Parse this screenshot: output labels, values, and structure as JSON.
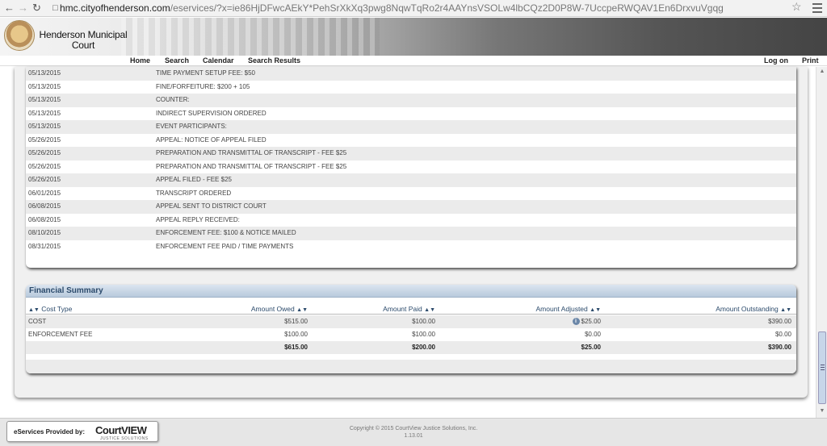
{
  "browser": {
    "url_domain": "hmc.cityofhenderson.com",
    "url_rest": "/eservices/?x=ie86HjDFwcAEkY*PehSrXkXq3pwg8NqwTqRo2r4AAYnsVSOLw4lbCQz2D0P8W-7UccpeRWQAV1En6DrxvuVgqg"
  },
  "header": {
    "court_name_line1": "Henderson Municipal",
    "court_name_line2": "Court",
    "nav": [
      "Home",
      "Search",
      "Calendar",
      "Search Results"
    ],
    "right_nav": [
      "Log on",
      "Print"
    ]
  },
  "events": [
    {
      "date": "05/13/2015",
      "text": "TIME PAYMENT SETUP FEE: $50"
    },
    {
      "date": "05/13/2015",
      "text": "FINE/FORFEITURE: $200 + 105"
    },
    {
      "date": "05/13/2015",
      "text": "COUNTER:"
    },
    {
      "date": "05/13/2015",
      "text": "INDIRECT SUPERVISION ORDERED"
    },
    {
      "date": "05/13/2015",
      "text": "EVENT PARTICIPANTS:"
    },
    {
      "date": "05/26/2015",
      "text": "APPEAL: NOTICE OF APPEAL FILED"
    },
    {
      "date": "05/26/2015",
      "text": "PREPARATION AND TRANSMITTAL OF TRANSCRIPT - FEE $25"
    },
    {
      "date": "05/26/2015",
      "text": "PREPARATION AND TRANSMITTAL OF TRANSCRIPT - FEE $25"
    },
    {
      "date": "05/26/2015",
      "text": "APPEAL FILED - FEE $25"
    },
    {
      "date": "06/01/2015",
      "text": "TRANSCRIPT ORDERED"
    },
    {
      "date": "06/08/2015",
      "text": "APPEAL SENT TO DISTRICT COURT"
    },
    {
      "date": "06/08/2015",
      "text": "APPEAL REPLY RECEIVED:"
    },
    {
      "date": "08/10/2015",
      "text": "ENFORCEMENT FEE: $100 & NOTICE MAILED"
    },
    {
      "date": "08/31/2015",
      "text": "ENFORCEMENT FEE PAID / TIME PAYMENTS"
    }
  ],
  "financial": {
    "title": "Financial Summary",
    "columns": [
      "Cost Type",
      "Amount Owed",
      "Amount Paid",
      "Amount Adjusted",
      "Amount Outstanding"
    ],
    "rows": [
      {
        "type": "COST",
        "owed": "$515.00",
        "paid": "$100.00",
        "adjusted": "$25.00",
        "outstanding": "$390.00"
      },
      {
        "type": "ENFORCEMENT FEE",
        "owed": "$100.00",
        "paid": "$100.00",
        "adjusted": "$0.00",
        "outstanding": "$0.00"
      }
    ],
    "totals": {
      "owed": "$615.00",
      "paid": "$200.00",
      "adjusted": "$25.00",
      "outstanding": "$390.00"
    }
  },
  "footer": {
    "provided_by": "eServices Provided by:",
    "logo_text": "CourtVIEW",
    "logo_tag": "JUSTICE SOLUTIONS",
    "copyright": "Copyright © 2015 CourtView Justice Solutions, Inc.",
    "version": "1.13.01"
  }
}
